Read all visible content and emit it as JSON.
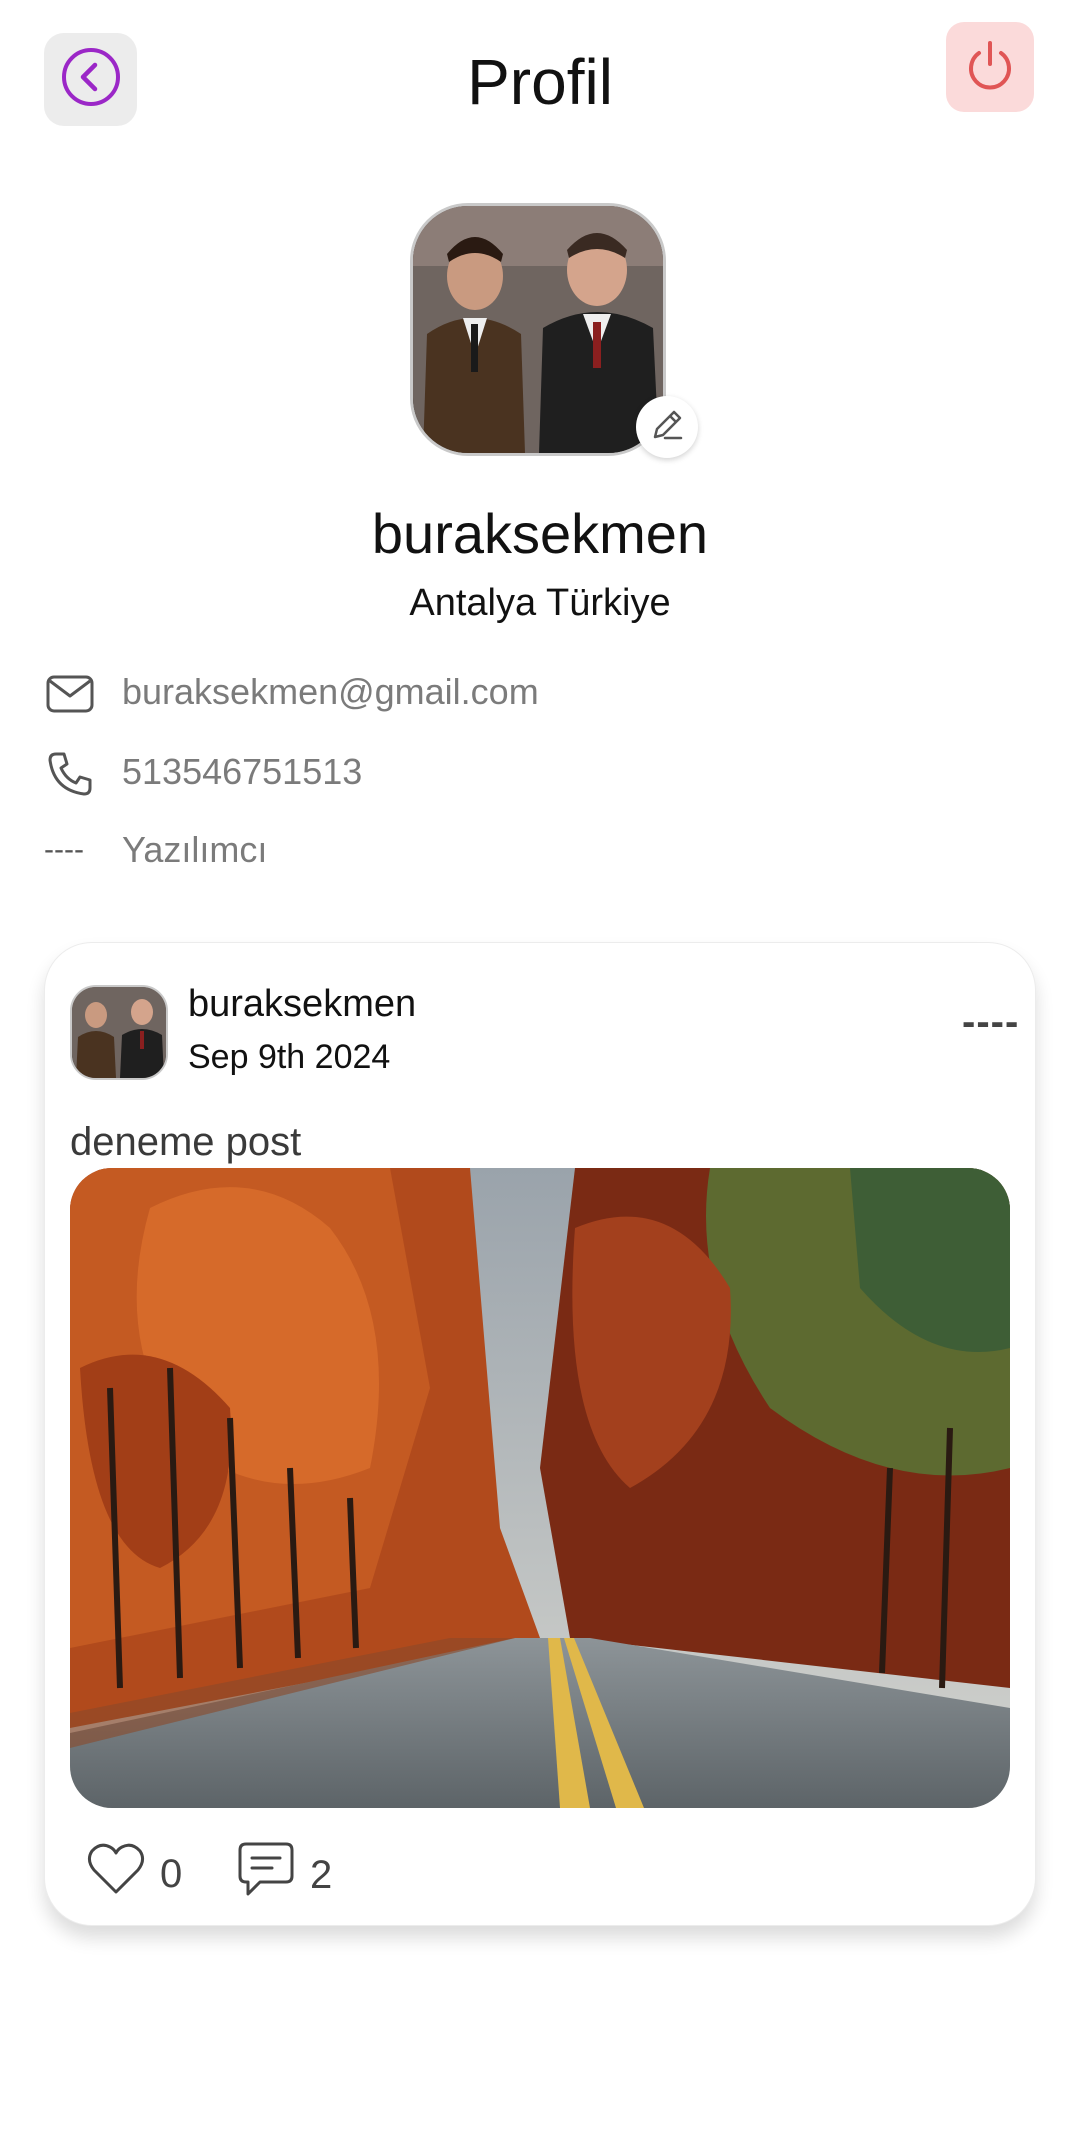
{
  "header": {
    "title": "Profil",
    "back_icon": "chevron-left-icon",
    "power_icon": "power-icon",
    "back_color": "#9b27c7",
    "power_color": "#e05555"
  },
  "profile": {
    "username": "buraksekmen",
    "location": "Antalya Türkiye",
    "edit_icon": "pencil-icon"
  },
  "info": {
    "email": "buraksekmen@gmail.com",
    "phone": "513546751513",
    "job_marker": "----",
    "job": "Yazılımcı"
  },
  "post": {
    "username": "buraksekmen",
    "date": "Sep 9th 2024",
    "text": "deneme post",
    "more_marker": "----",
    "likes": "0",
    "comments": "2"
  }
}
